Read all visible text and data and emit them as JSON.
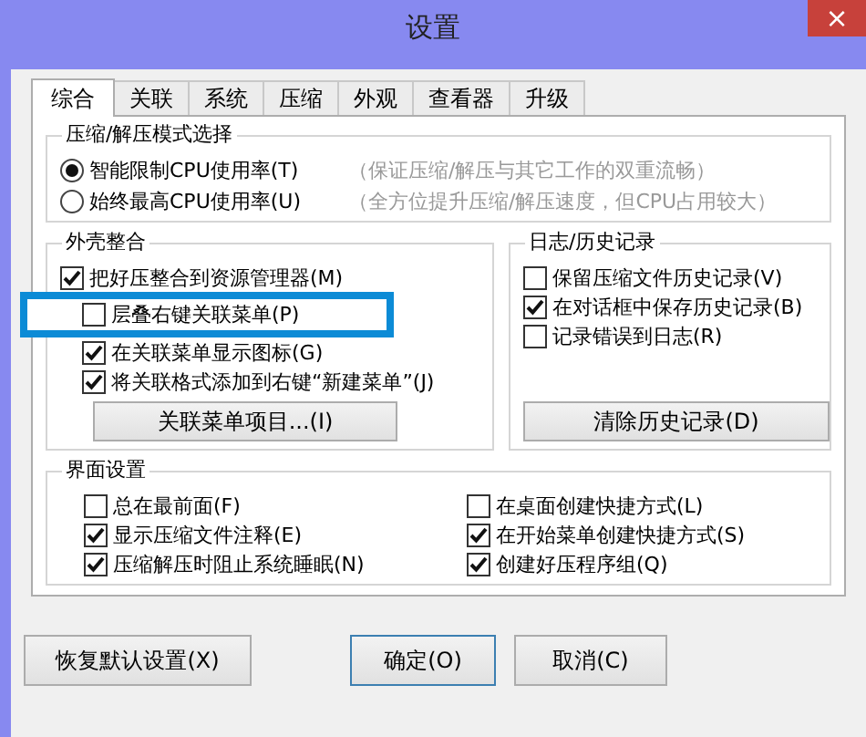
{
  "window": {
    "title": "设置",
    "close": "×"
  },
  "tabs": [
    {
      "label": "综合",
      "selected": true
    },
    {
      "label": "关联",
      "selected": false
    },
    {
      "label": "系统",
      "selected": false
    },
    {
      "label": "压缩",
      "selected": false
    },
    {
      "label": "外观",
      "selected": false
    },
    {
      "label": "查看器",
      "selected": false
    },
    {
      "label": "升级",
      "selected": false
    }
  ],
  "compress_mode": {
    "title": "压缩/解压模式选择",
    "options": [
      {
        "label": "智能限制CPU使用率(T)",
        "hint": "（保证压缩/解压与其它工作的双重流畅）",
        "selected": true
      },
      {
        "label": "始终最高CPU使用率(U)",
        "hint": "（全方位提升压缩/解压速度，但CPU占用较大）",
        "selected": false
      }
    ]
  },
  "shell": {
    "title": "外壳整合",
    "items": [
      {
        "label": "把好压整合到资源管理器(M)",
        "checked": true,
        "highlighted": false
      },
      {
        "label": "层叠右键关联菜单(P)",
        "checked": false,
        "highlighted": true
      },
      {
        "label": "在关联菜单显示图标(G)",
        "checked": true,
        "highlighted": false
      },
      {
        "label": "将关联格式添加到右键“新建菜单”(J)",
        "checked": true,
        "highlighted": false
      }
    ],
    "button": "关联菜单项目...(I)"
  },
  "history": {
    "title": "日志/历史记录",
    "items": [
      {
        "label": "保留压缩文件历史记录(V)",
        "checked": false
      },
      {
        "label": "在对话框中保存历史记录(B)",
        "checked": true
      },
      {
        "label": "记录错误到日志(R)",
        "checked": false
      }
    ],
    "button": "清除历史记录(D)"
  },
  "interface": {
    "title": "界面设置",
    "items": [
      {
        "label": "总在最前面(F)",
        "checked": false
      },
      {
        "label": "在桌面创建快捷方式(L)",
        "checked": false
      },
      {
        "label": "显示压缩文件注释(E)",
        "checked": true
      },
      {
        "label": "在开始菜单创建快捷方式(S)",
        "checked": true
      },
      {
        "label": "压缩解压时阻止系统睡眠(N)",
        "checked": true
      },
      {
        "label": "创建好压程序组(Q)",
        "checked": true
      }
    ]
  },
  "buttons": [
    {
      "label": "恢复默认设置(X)",
      "default": false
    },
    {
      "label": "确定(O)",
      "default": true
    },
    {
      "label": "取消(C)",
      "default": false
    }
  ]
}
